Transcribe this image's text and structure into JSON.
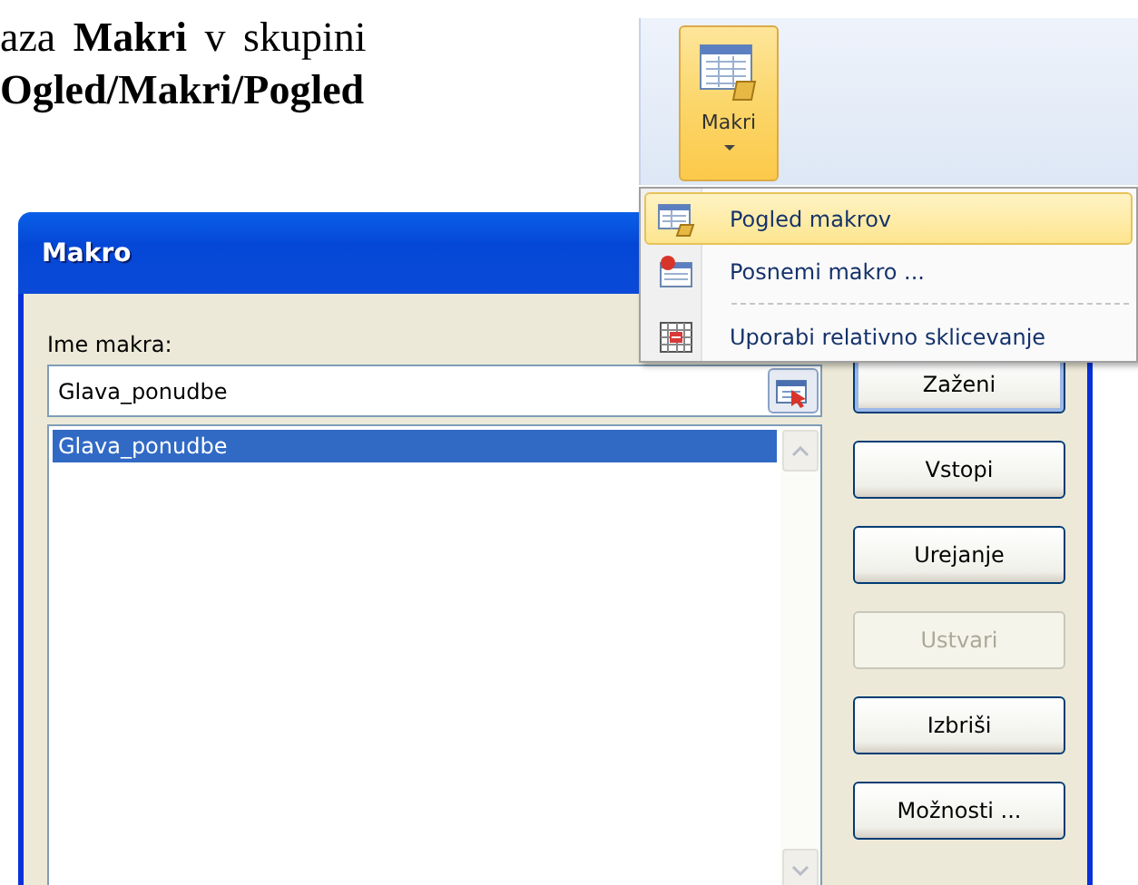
{
  "document_text": [
    "aza **Makri** v skupini",
    "Ogled/Makri/Pogled"
  ],
  "ribbon": {
    "button": {
      "label": "Makri",
      "selected": true
    }
  },
  "menu": {
    "items": [
      {
        "label": "Pogled makrov",
        "kind": "view",
        "selected": true
      },
      {
        "label": "Posnemi makro ...",
        "kind": "record",
        "selected": false
      },
      {
        "label": "Uporabi relativno sklicevanje",
        "kind": "relative",
        "selected": false
      }
    ]
  },
  "dialog": {
    "title": "Makro",
    "field_label": "Ime makra:",
    "field_value": "Glava_ponudbe",
    "macros": [
      {
        "name": "Glava_ponudbe",
        "selected": true
      }
    ],
    "buttons": [
      {
        "label": "Zaženi",
        "default": true,
        "disabled": false
      },
      {
        "label": "Vstopi",
        "default": false,
        "disabled": false
      },
      {
        "label": "Urejanje",
        "default": false,
        "disabled": false
      },
      {
        "label": "Ustvari",
        "default": false,
        "disabled": true
      },
      {
        "label": "Izbriši",
        "default": false,
        "disabled": false
      },
      {
        "label": "Možnosti ...",
        "default": false,
        "disabled": false
      }
    ]
  }
}
